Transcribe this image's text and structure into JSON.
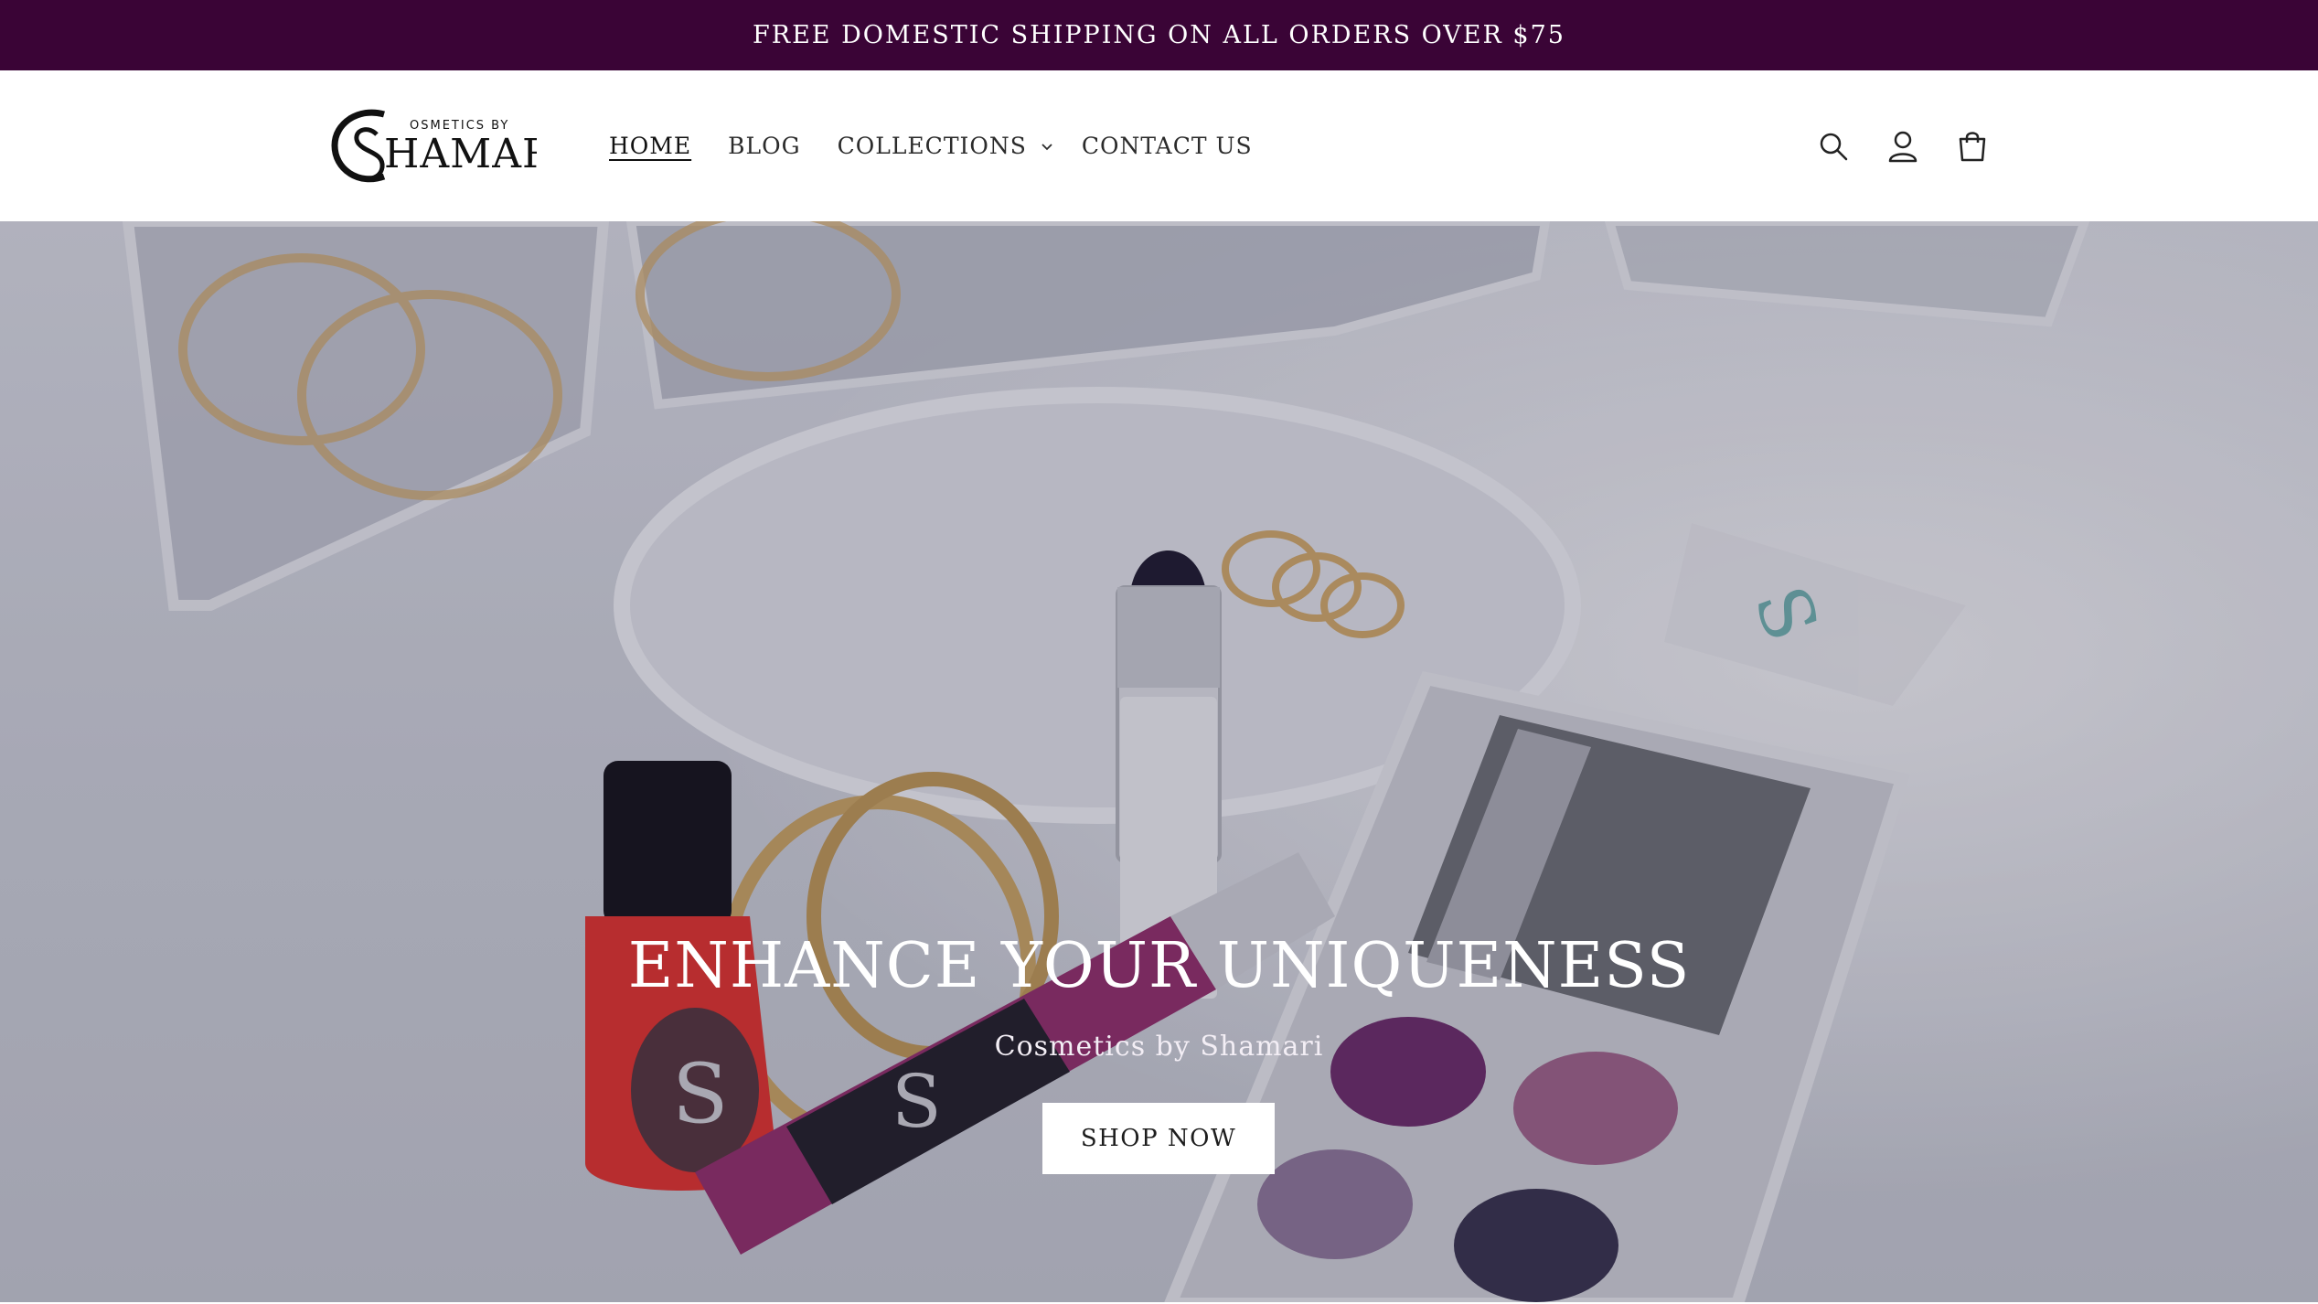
{
  "announcement": {
    "text": "FREE DOMESTIC SHIPPING ON ALL ORDERS OVER $75"
  },
  "header": {
    "logo": {
      "top_text": "OSMETICS BY",
      "main_text": "HAMARI",
      "icon": "logo-cs-monogram"
    },
    "nav": [
      {
        "label": "HOME",
        "active": true
      },
      {
        "label": "BLOG",
        "active": false
      },
      {
        "label": "COLLECTIONS",
        "active": false,
        "dropdown": true
      },
      {
        "label": "CONTACT US",
        "active": false
      }
    ],
    "icons": [
      "search-icon",
      "account-icon",
      "cart-icon"
    ]
  },
  "hero": {
    "title": "ENHANCE YOUR UNIQUENESS",
    "subtitle": "Cosmetics by Shamari",
    "button_label": "SHOP NOW"
  },
  "colors": {
    "announcement_bg": "#3a0436",
    "header_bg": "#ffffff",
    "button_bg": "#ffffff",
    "hero_text": "#ffffff"
  }
}
